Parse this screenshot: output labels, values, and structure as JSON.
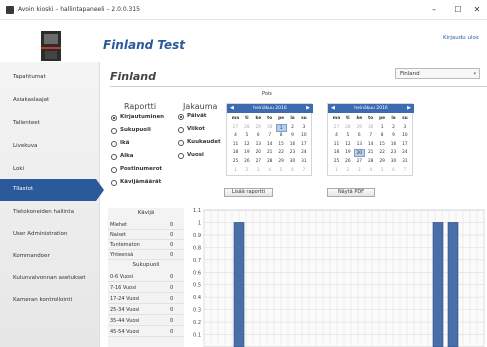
{
  "window": {
    "title": "Avoin kioski – hallintapaneeli – 2.0.0.315",
    "minimize": "–",
    "maximize": "☐",
    "close": "✕"
  },
  "header": {
    "app_title": "Finland Test",
    "login_link": "Kirjaudu ulos"
  },
  "sidebar": {
    "items": [
      {
        "label": "Tapahtumat"
      },
      {
        "label": "Asiakaslaajat"
      },
      {
        "label": "Tallenteet"
      },
      {
        "label": "Livekuva"
      },
      {
        "label": "Loki"
      },
      {
        "label": "Tilastot",
        "active": true
      },
      {
        "label": "Tietokoneiden hallinta"
      },
      {
        "label": "User Administration"
      },
      {
        "label": "Kommandoer"
      },
      {
        "label": "Kulunvalvonnan asetukset"
      },
      {
        "label": "Kameran kontrollointi"
      }
    ]
  },
  "main": {
    "title": "Finland",
    "location_select": "Finland",
    "report": {
      "title": "Raportti",
      "options": [
        {
          "label": "Kirjautuminen",
          "checked": true
        },
        {
          "label": "Sukupuoli",
          "checked": false
        },
        {
          "label": "Ikä",
          "checked": false
        },
        {
          "label": "Alka",
          "checked": false
        },
        {
          "label": "Postinumerot",
          "checked": false
        },
        {
          "label": "Kävijämäärät",
          "checked": false
        }
      ]
    },
    "distribution": {
      "title": "Jakauma",
      "options": [
        {
          "label": "Päivät",
          "checked": true
        },
        {
          "label": "Viikot",
          "checked": false
        },
        {
          "label": "Kuukaudet",
          "checked": false
        },
        {
          "label": "Vuosi",
          "checked": false
        }
      ]
    },
    "range_label": "Pois",
    "range_dash": "-",
    "calendars": [
      {
        "month": "heinäkuu 2016",
        "prev": "◀",
        "next": "▶",
        "dow": [
          "ma",
          "ti",
          "ke",
          "to",
          "pe",
          "la",
          "su"
        ],
        "weeks": [
          [
            "27",
            "28",
            "29",
            "30",
            "1",
            "2",
            "3"
          ],
          [
            "4",
            "5",
            "6",
            "7",
            "8",
            "9",
            "10"
          ],
          [
            "11",
            "12",
            "13",
            "14",
            "15",
            "16",
            "17"
          ],
          [
            "18",
            "19",
            "20",
            "21",
            "22",
            "23",
            "24"
          ],
          [
            "25",
            "26",
            "27",
            "28",
            "29",
            "30",
            "31"
          ],
          [
            "1",
            "2",
            "3",
            "4",
            "5",
            "6",
            "7"
          ]
        ],
        "selected": "1"
      },
      {
        "month": "heinäkuu 2016",
        "prev": "◀",
        "next": "▶",
        "dow": [
          "ma",
          "ti",
          "ke",
          "to",
          "pe",
          "la",
          "su"
        ],
        "weeks": [
          [
            "27",
            "28",
            "29",
            "30",
            "1",
            "2",
            "3"
          ],
          [
            "4",
            "5",
            "6",
            "7",
            "8",
            "9",
            "10"
          ],
          [
            "11",
            "12",
            "13",
            "14",
            "15",
            "16",
            "17"
          ],
          [
            "18",
            "19",
            "20",
            "21",
            "22",
            "23",
            "24"
          ],
          [
            "25",
            "26",
            "27",
            "28",
            "29",
            "30",
            "31"
          ],
          [
            "1",
            "2",
            "3",
            "4",
            "5",
            "6",
            "7"
          ]
        ],
        "selected": "20"
      }
    ],
    "add_report_button": "Lisää raportti",
    "show_pdf_button": "Näytä PDF",
    "stats": {
      "visitors_header": "Kävijä",
      "visitors": [
        {
          "label": "Miehet",
          "value": "0"
        },
        {
          "label": "Naiset",
          "value": "0"
        },
        {
          "label": "Tuntematon",
          "value": "0"
        },
        {
          "label": "Yhteensä",
          "value": "0"
        }
      ],
      "gender_header": "Sukupuoli",
      "ages": [
        {
          "label": "0-6 Vuosi",
          "value": "0"
        },
        {
          "label": "7-16 Vuosi",
          "value": "0"
        },
        {
          "label": "17-24 Vuosi",
          "value": "0"
        },
        {
          "label": "25-34 Vuosi",
          "value": "0"
        },
        {
          "label": "35-44 Vuosi",
          "value": "0"
        },
        {
          "label": "45-54 Vuosi",
          "value": "0"
        }
      ]
    }
  },
  "chart_data": {
    "type": "bar",
    "y_ticks": [
      "1.1",
      "1",
      "0.9",
      "0.8",
      "0.7",
      "0.6",
      "0.5",
      "0.4",
      "0.3",
      "0.2",
      "0.1"
    ],
    "ylim": [
      0,
      1.1
    ],
    "values": [
      1,
      1,
      1
    ],
    "bar_color": "#4a6fa8",
    "grid": true
  }
}
